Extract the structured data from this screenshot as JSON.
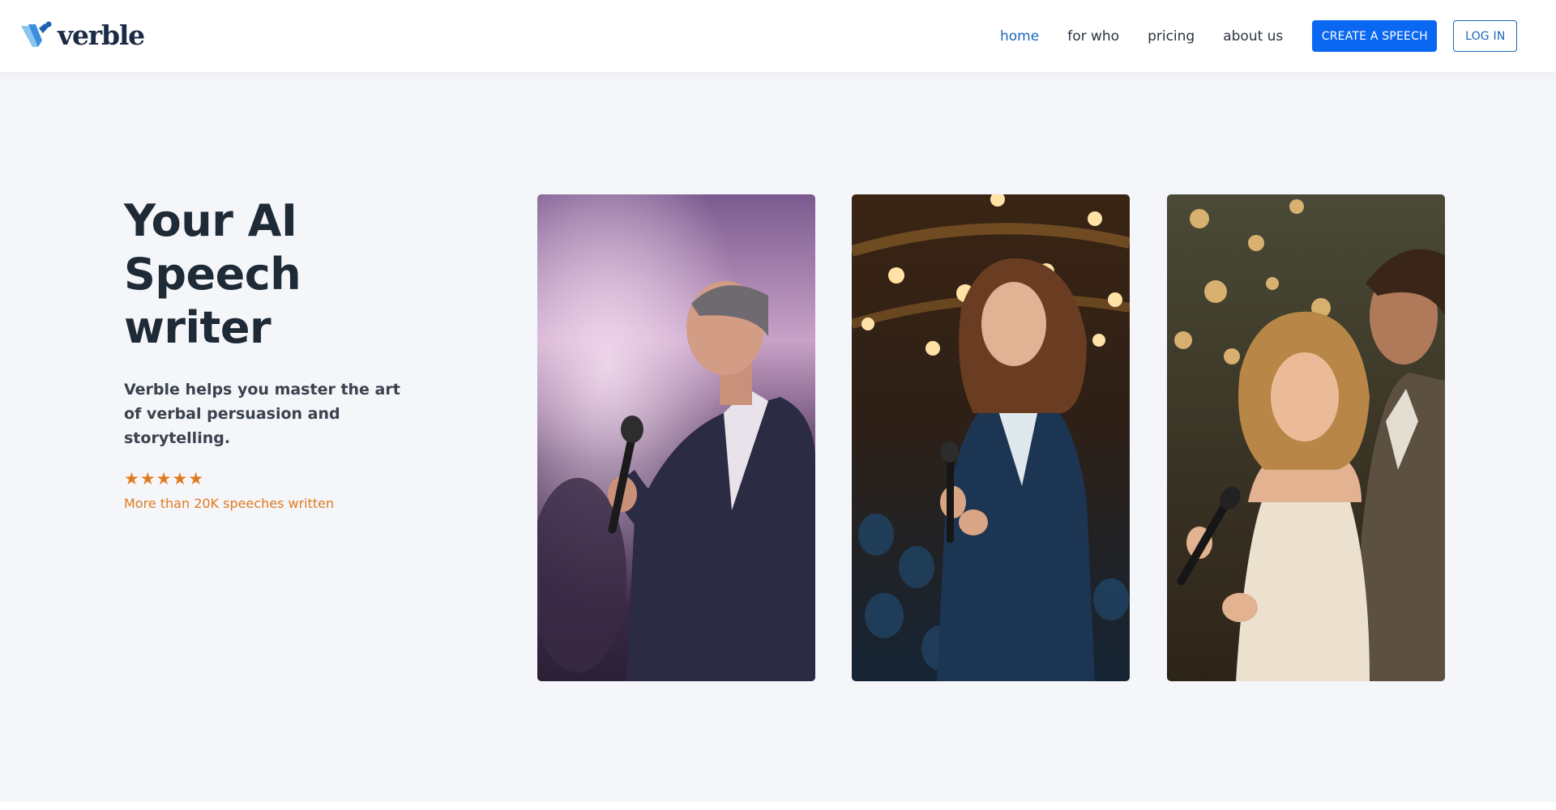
{
  "brand": {
    "name": "verble",
    "logo_icon": "v-mark-icon",
    "primary_color": "#0a67f2",
    "accent_color": "#e07a1f"
  },
  "nav": {
    "items": [
      {
        "label": "home",
        "active": true
      },
      {
        "label": "for who",
        "active": false
      },
      {
        "label": "pricing",
        "active": false
      },
      {
        "label": "about us",
        "active": false
      }
    ],
    "create_label": "CREATE A SPEECH",
    "login_label": "LOG IN"
  },
  "hero": {
    "title_lines": [
      "Your AI",
      "Speech",
      "writer"
    ],
    "subtitle": "Verble helps you master the art of verbal persuasion and storytelling.",
    "rating": {
      "stars": "★★★★★",
      "value": 5,
      "max": 5,
      "caption": "More than 20K speeches written"
    }
  },
  "photos": [
    {
      "subject": "man speaking into microphone on stage"
    },
    {
      "subject": "woman in blazer holding microphone in auditorium"
    },
    {
      "subject": "bride laughing with microphone beside groom"
    }
  ]
}
